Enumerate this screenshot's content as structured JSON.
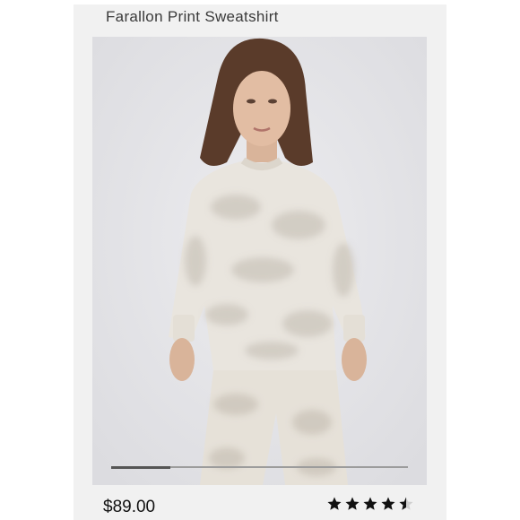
{
  "product": {
    "title": "Farallon Print Sweatshirt",
    "price": "$89.00",
    "rating": 4.5,
    "rating_max": 5,
    "image": {
      "subject": "product-photo"
    }
  },
  "carousel": {
    "progress": 0.2,
    "active_index": 0
  },
  "icons": {
    "star": "star-icon",
    "half_star": "star-half-icon"
  },
  "colors": {
    "card_bg": "#f1f1f1",
    "photo_bg": "#e7e7ea",
    "star": "#111111",
    "text": "#3a3a3a"
  }
}
